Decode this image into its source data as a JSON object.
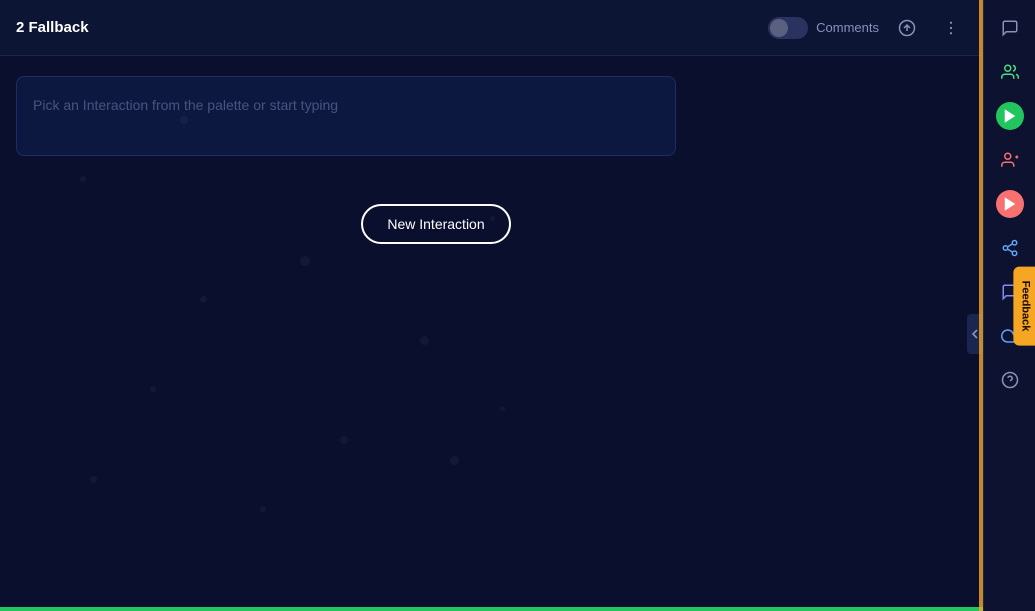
{
  "header": {
    "title": "2 Fallback",
    "comments_label": "Comments",
    "toggle_active": false
  },
  "content": {
    "placeholder": "Pick an Interaction from the palette or start typing",
    "new_interaction_label": "New Interaction"
  },
  "sidebar": {
    "icons": [
      {
        "name": "chat-icon",
        "color": "#8a90b8",
        "bg": "transparent"
      },
      {
        "name": "users-icon",
        "color": "#4ade80",
        "bg": "transparent"
      },
      {
        "name": "play-icon",
        "color": "#22c55e",
        "bg": "transparent"
      },
      {
        "name": "users-broadcast-icon",
        "color": "#f87171",
        "bg": "transparent"
      },
      {
        "name": "play-circle-icon",
        "color": "#f87171",
        "bg": "transparent"
      },
      {
        "name": "share-icon",
        "color": "#60a5fa",
        "bg": "transparent"
      },
      {
        "name": "message-square-icon",
        "color": "#818cf8",
        "bg": "transparent"
      },
      {
        "name": "cloud-icon",
        "color": "#60a5fa",
        "bg": "transparent"
      },
      {
        "name": "help-icon",
        "color": "#8a90b8",
        "bg": "transparent"
      }
    ],
    "feedback_label": "Feedback"
  },
  "colors": {
    "background": "#0a0f2e",
    "topbar": "#0d1535",
    "accent_orange": "#f5a623",
    "accent_green": "#22c55e"
  }
}
